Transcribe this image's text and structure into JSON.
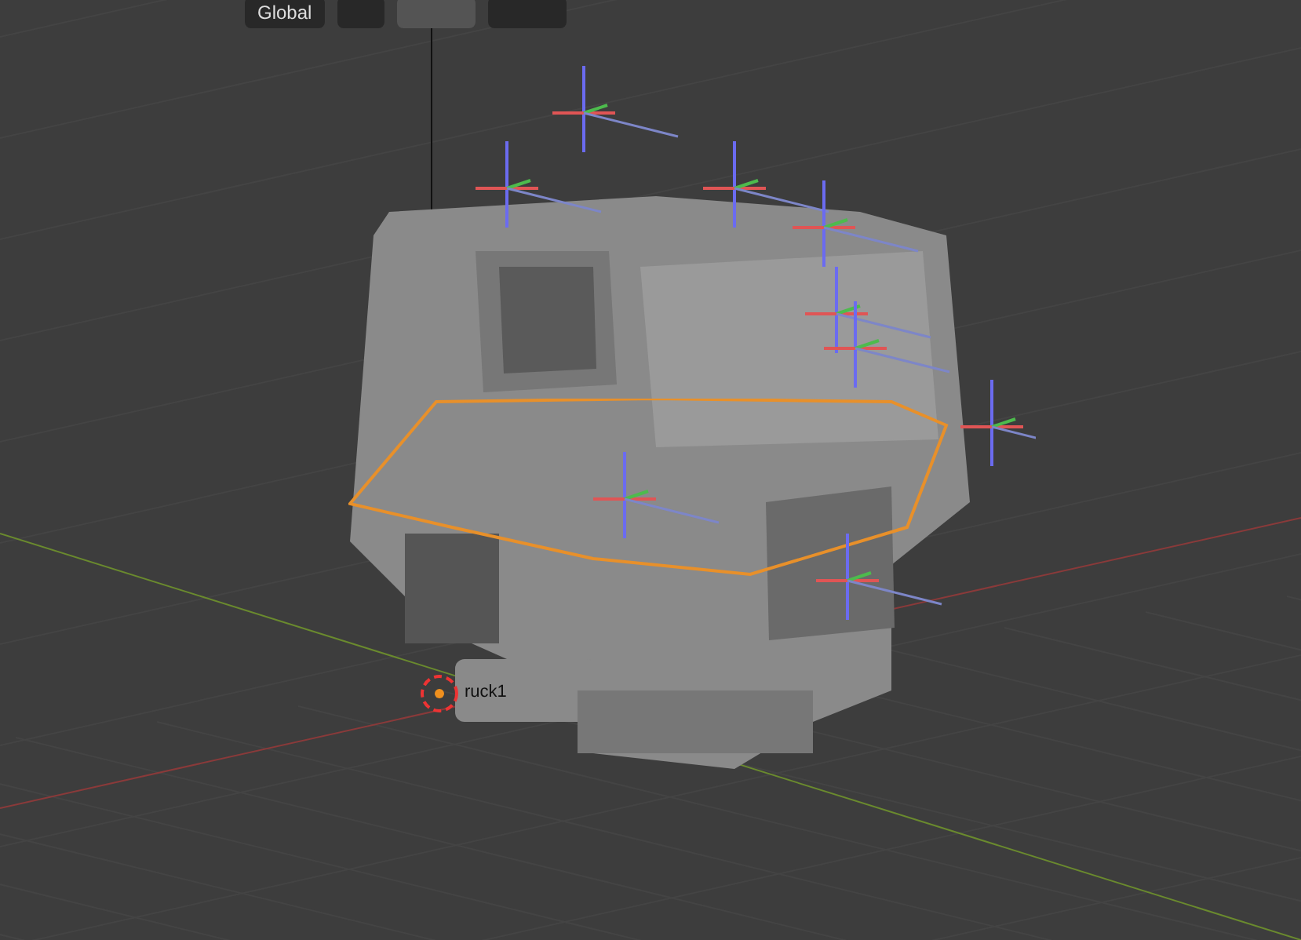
{
  "header": {
    "orientation": {
      "label": "Global"
    },
    "pivot": {
      "expanded": false
    },
    "snap": {
      "selected": true
    },
    "proportional": {
      "selected": false
    }
  },
  "viewport": {
    "object_label": "ruck1",
    "selected_outline": true
  }
}
